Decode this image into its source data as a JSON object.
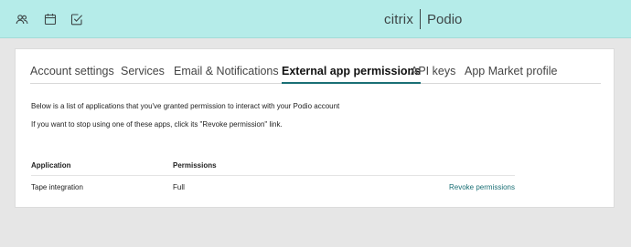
{
  "topbar": {
    "icons": [
      "people-icon",
      "calendar-icon",
      "tasks-check-icon"
    ],
    "brand_left": "citrix",
    "brand_right": "Podio",
    "background": "#b5ece9"
  },
  "tabs": [
    {
      "label": "Account settings",
      "active": false
    },
    {
      "label": "Services",
      "active": false
    },
    {
      "label": "Email & Notifications",
      "active": false
    },
    {
      "label": "External app permissions",
      "active": true
    },
    {
      "label": "API keys",
      "active": false
    },
    {
      "label": "App Market profile",
      "active": false
    }
  ],
  "intro": {
    "line1": "Below is a list of applications that you've granted permission to interact with your Podio account",
    "line2": "If you want to stop using one of these apps, click its \"Revoke permission\" link."
  },
  "table": {
    "headers": {
      "application": "Application",
      "permissions": "Permissions"
    },
    "rows": [
      {
        "application": "Tape integration",
        "permissions": "Full",
        "action": "Revoke permissions"
      }
    ]
  },
  "colors": {
    "accent": "#1a6f75",
    "page_background": "#e6e6e6"
  }
}
